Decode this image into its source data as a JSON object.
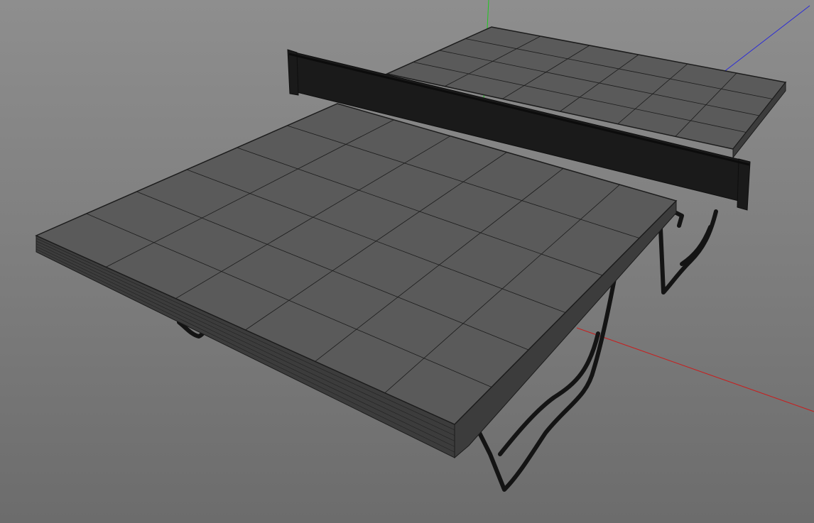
{
  "viewport": {
    "view": "perspective",
    "display_mode": "wireframe-on-shaded",
    "background_color": "#808080"
  },
  "axes": {
    "x_color": "#c81e1e",
    "y_color": "#1ec81e",
    "z_color": "#2a2ad8"
  },
  "model": {
    "object": "ping-pong-table",
    "table_top_color": "#5a5a5a",
    "wire_color": "#1c1c1c",
    "net_color": "#1a1a1a",
    "legs_color": "#141414"
  }
}
